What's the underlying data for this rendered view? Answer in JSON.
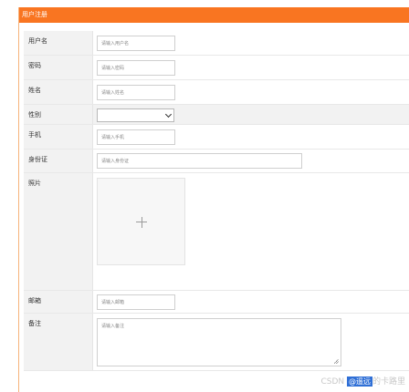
{
  "header": {
    "title": "用户注册"
  },
  "form": {
    "username": {
      "label": "用户名",
      "placeholder": "请输入用户名"
    },
    "password": {
      "label": "密码",
      "placeholder": "请输入密码"
    },
    "name": {
      "label": "姓名",
      "placeholder": "请输入姓名"
    },
    "gender": {
      "label": "性别",
      "value": ""
    },
    "phone": {
      "label": "手机",
      "placeholder": "请输入手机"
    },
    "id_card": {
      "label": "身份证",
      "placeholder": "请输入身份证"
    },
    "photo": {
      "label": "照片",
      "icon": "plus-icon"
    },
    "email": {
      "label": "邮箱",
      "placeholder": "请输入邮箱"
    },
    "note": {
      "label": "备注",
      "placeholder": "请输入备注"
    }
  },
  "watermark": {
    "prefix": "CSDN ",
    "badge": "@遥远",
    "suffix": "的卡路里"
  },
  "colors": {
    "accent": "#f97521",
    "label_bg": "#f2f2f2",
    "border": "#e8e8e8"
  }
}
